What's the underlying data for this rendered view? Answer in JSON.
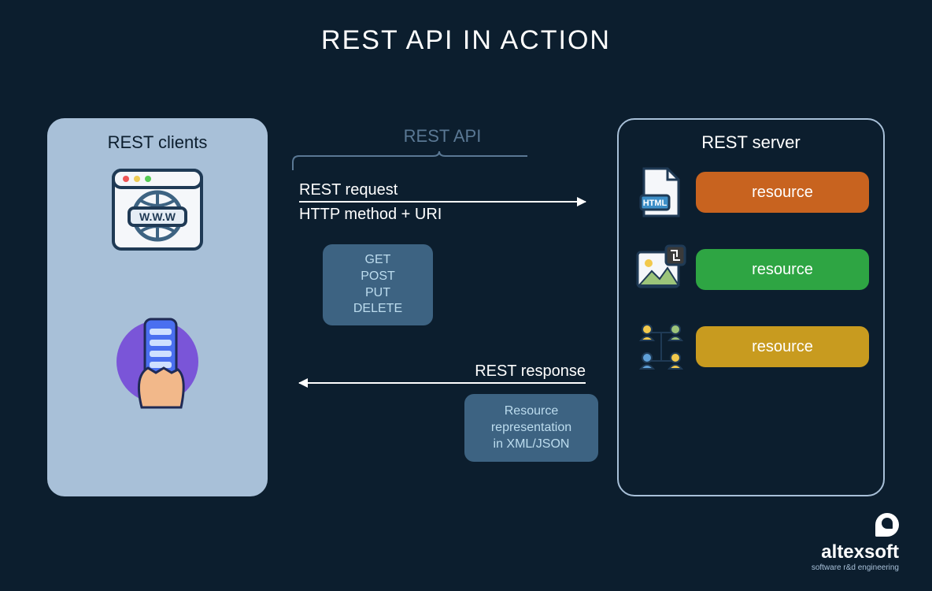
{
  "title": "REST API IN ACTION",
  "clients": {
    "heading": "REST clients",
    "browser_label": "WWW"
  },
  "api": {
    "label": "REST API",
    "request": {
      "caption": "REST request",
      "sub": "HTTP method + URI"
    },
    "response": {
      "caption": "REST response"
    },
    "methods": [
      "GET",
      "POST",
      "PUT",
      "DELETE"
    ],
    "response_note": {
      "l1": "Resource",
      "l2": "representation",
      "l3": "in XML/JSON"
    }
  },
  "server": {
    "heading": "REST server",
    "resources": [
      {
        "label": "resource",
        "color": "res-orange",
        "icon": "html"
      },
      {
        "label": "resource",
        "color": "res-green",
        "icon": "image"
      },
      {
        "label": "resource",
        "color": "res-yellow",
        "icon": "people"
      }
    ],
    "html_badge": "HTML"
  },
  "brand": {
    "name": "altexsoft",
    "tagline": "software r&d engineering"
  }
}
